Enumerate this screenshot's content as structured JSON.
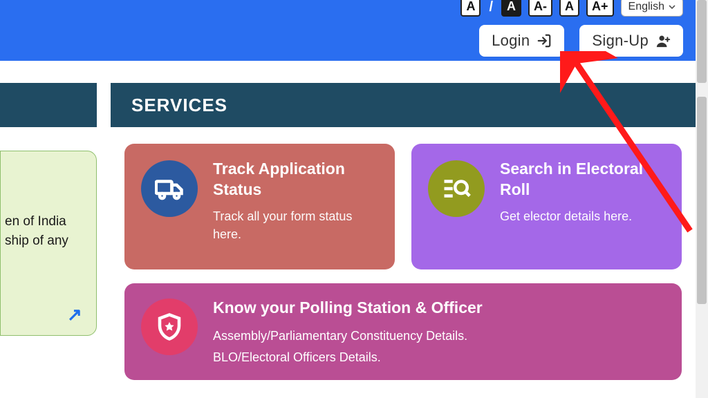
{
  "accessibility": {
    "a_light": "A",
    "sep": "/",
    "a_dark": "A",
    "a_minus": "A-",
    "a_normal": "A",
    "a_plus": "A+",
    "language": "English"
  },
  "auth": {
    "login": "Login",
    "signup": "Sign-Up"
  },
  "services_heading": "SERVICES",
  "left_card": {
    "line1": "en of India",
    "line2": "ship of any",
    "arrow": "↗"
  },
  "cards": {
    "track": {
      "title": "Track Application Status",
      "desc": "Track all your form status here."
    },
    "search": {
      "title": "Search in Electoral Roll",
      "desc": "Get elector details here."
    },
    "polling": {
      "title": "Know your Polling Station & Officer",
      "line1": "Assembly/Parliamentary Constituency Details.",
      "line2": "BLO/Electoral Officers Details."
    }
  }
}
